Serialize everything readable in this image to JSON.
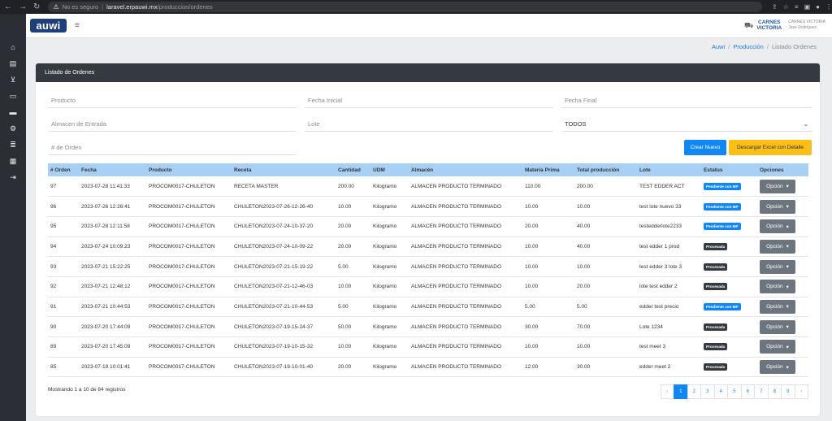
{
  "browser": {
    "security_label": "No es seguro",
    "url_host": "laravel.erpauwi.mx",
    "url_path": "/produccion/ordenes"
  },
  "header": {
    "logo_text": "auwi",
    "brand_line1": "CARNES",
    "brand_line2": "VICTORIA",
    "company": "CARNES VICTORIA",
    "user": "Jose Rodriguez"
  },
  "breadcrumb": {
    "home": "Auwi",
    "section": "Producción",
    "current": "Listado Ordenes"
  },
  "card": {
    "title": "Listado de Ordenes"
  },
  "filters": {
    "producto": "Producto",
    "fecha_inicial": "Fecha Inicial",
    "fecha_final": "Fecha Final",
    "almacen": "Almacen de Entrada",
    "lote": "Lote",
    "estatus_selected": "TODOS",
    "orden": "# de Orden"
  },
  "buttons": {
    "crear": "Crear Nuevo",
    "descargar": "Descargar Excel con Detalle"
  },
  "table": {
    "headers": [
      "# Orden",
      "Fecha",
      "Producto",
      "Receta",
      "Cantidad",
      "UDM",
      "Almacén",
      "Materia Prima",
      "Total producción",
      "Lote",
      "Estatus",
      "Opciones"
    ],
    "option_label": "Opción",
    "rows": [
      {
        "orden": "97",
        "fecha": "2023-07-28 11:41:33",
        "producto": "PROCOM0017-CHULETON",
        "receta": "RECETA MASTER",
        "cantidad": "200.00",
        "udm": "Kilogramo",
        "almacen": "ALMACEN PRODUCTO TERMINADO",
        "materia": "110.00",
        "total": "200.00",
        "lote": "TEST EDDER ACT",
        "estatus": "Pendiente con MP",
        "tipo": "pend"
      },
      {
        "orden": "96",
        "fecha": "2023-07-26 12:26:41",
        "producto": "PROCOM0017-CHULETON",
        "receta": "CHULETON2023-07-26-12-26-40",
        "cantidad": "10.00",
        "udm": "Kilogramo",
        "almacen": "ALMACEN PRODUCTO TERMINADO",
        "materia": "10.00",
        "total": "10.00",
        "lote": "test lote nuevo 33",
        "estatus": "Pendiente con MP",
        "tipo": "pend"
      },
      {
        "orden": "95",
        "fecha": "2023-07-28 12:11:58",
        "producto": "PROCOM0017-CHULETON",
        "receta": "CHULETON2023-07-24-10-37-20",
        "cantidad": "20.00",
        "udm": "Kilogramo",
        "almacen": "ALMACEN PRODUCTO TERMINADO",
        "materia": "20.00",
        "total": "40.00",
        "lote": "testedderlote2233",
        "estatus": "Pendiente con MP",
        "tipo": "pend"
      },
      {
        "orden": "94",
        "fecha": "2023-07-24 10:09:23",
        "producto": "PROCOM0017-CHULETON",
        "receta": "CHULETON2023-07-24-10-09-22",
        "cantidad": "20.00",
        "udm": "Kilogramo",
        "almacen": "ALMACEN PRODUCTO TERMINADO",
        "materia": "10.00",
        "total": "40.00",
        "lote": "test edder 1 prod",
        "estatus": "Procesada",
        "tipo": "proc"
      },
      {
        "orden": "93",
        "fecha": "2023-07-21 15:22:25",
        "producto": "PROCOM0017-CHULETON",
        "receta": "CHULETON2023-07-21-15-19-22",
        "cantidad": "5.00",
        "udm": "Kilogramo",
        "almacen": "ALMACEN PRODUCTO TERMINADO",
        "materia": "10.00",
        "total": "10.00",
        "lote": "test edder 3 lote 3",
        "estatus": "Procesada",
        "tipo": "proc"
      },
      {
        "orden": "92",
        "fecha": "2023-07-21 12:48:12",
        "producto": "PROCOM0017-CHULETON",
        "receta": "CHULETON2023-07-21-12-46-03",
        "cantidad": "10.00",
        "udm": "Kilogramo",
        "almacen": "ALMACEN PRODUCTO TERMINADO",
        "materia": "10.00",
        "total": "20.00",
        "lote": "lote test edder 2",
        "estatus": "Procesada",
        "tipo": "proc"
      },
      {
        "orden": "91",
        "fecha": "2023-07-21 10:44:53",
        "producto": "PROCOM0017-CHULETON",
        "receta": "CHULETON2023-07-21-10-44-53",
        "cantidad": "5.00",
        "udm": "Kilogramo",
        "almacen": "ALMACEN PRODUCTO TERMINADO",
        "materia": "5.00",
        "total": "5.00",
        "lote": "edder test precio",
        "estatus": "Pendiente con MP",
        "tipo": "pend"
      },
      {
        "orden": "90",
        "fecha": "2023-07-20 17:44:09",
        "producto": "PROCOM0017-CHULETON",
        "receta": "CHULETON2023-07-19-15-24-37",
        "cantidad": "50.00",
        "udm": "Kilogramo",
        "almacen": "ALMACEN PRODUCTO TERMINADO",
        "materia": "30.00",
        "total": "70.00",
        "lote": "Lote 1234",
        "estatus": "Procesada",
        "tipo": "proc"
      },
      {
        "orden": "89",
        "fecha": "2023-07-20 17:45:09",
        "producto": "PROCOM0017-CHULETON",
        "receta": "CHULETON2023-07-19-10-15-32",
        "cantidad": "10.00",
        "udm": "Kilogramo",
        "almacen": "ALMACEN PRODUCTO TERMINADO",
        "materia": "10.00",
        "total": "10.00",
        "lote": "test meet 3",
        "estatus": "Procesada",
        "tipo": "proc"
      },
      {
        "orden": "85",
        "fecha": "2023-07-19 10:01:41",
        "producto": "PROCOM0017-CHULETON",
        "receta": "CHULETON2023-07-19-10-01-40",
        "cantidad": "20.00",
        "udm": "Kilogramo",
        "almacen": "ALMACEN PRODUCTO TERMINADO",
        "materia": "12.00",
        "total": "30.00",
        "lote": "edder meet 2",
        "estatus": "Procesada",
        "tipo": "proc"
      }
    ]
  },
  "summary": "Mostrando 1 a 10 de 84 registros",
  "pagination": {
    "prev": "‹",
    "pages": [
      "1",
      "2",
      "3",
      "4",
      "5",
      "6",
      "7",
      "8",
      "9"
    ],
    "next": "›",
    "active": "1"
  },
  "icons": {
    "sidebar": [
      "home-icon",
      "warehouse-icon",
      "cart-icon",
      "inbox-icon",
      "archive-icon",
      "gears-icon",
      "layers-icon",
      "calculator-icon",
      "logout-icon"
    ]
  },
  "colors": {
    "primary": "#1187f5",
    "warning": "#fbbf17",
    "dark": "#343a40",
    "table_header": "#a8d0f5"
  }
}
